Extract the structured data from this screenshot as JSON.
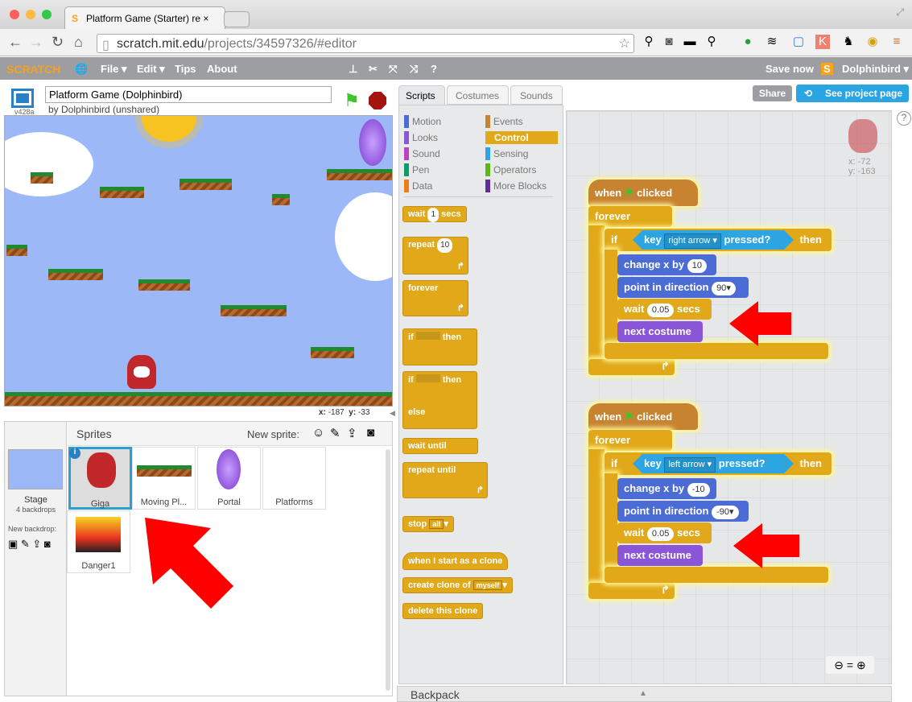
{
  "browser": {
    "tab_title": "Platform Game (Starter) re",
    "url_host": "scratch.mit.edu",
    "url_path": "/projects/34597326/#editor"
  },
  "menu": {
    "logo": "SCRATCH",
    "items": [
      "File ▾",
      "Edit ▾",
      "Tips",
      "About"
    ],
    "save_now": "Save now",
    "user": "Dolphinbird ▾"
  },
  "project": {
    "title": "Platform Game (Dolphinbird)",
    "byline": "by Dolphinbird (unshared)",
    "version": "v428a"
  },
  "stage": {
    "x_label": "x:",
    "x": "-187",
    "y_label": "y:",
    "y": "-33"
  },
  "sprites": {
    "header": "Sprites",
    "new_sprite": "New sprite:",
    "stage_label": "Stage",
    "stage_sub": "4 backdrops",
    "new_backdrop": "New backdrop:",
    "items": [
      "Giga",
      "Moving Pl...",
      "Portal",
      "Platforms",
      "Danger1"
    ]
  },
  "tabs": [
    "Scripts",
    "Costumes",
    "Sounds"
  ],
  "buttons": {
    "share": "Share",
    "see_project": "See project page"
  },
  "categories": {
    "left": [
      "Motion",
      "Looks",
      "Sound",
      "Pen",
      "Data"
    ],
    "right": [
      "Events",
      "Control",
      "Sensing",
      "Operators",
      "More Blocks"
    ],
    "selected": "Control",
    "colors": {
      "Motion": "#4a6cd4",
      "Looks": "#8a55d7",
      "Sound": "#bb42c3",
      "Pen": "#0e9a6c",
      "Data": "#ee7d16",
      "Events": "#c88330",
      "Control": "#e1a91a",
      "Sensing": "#2ca5e2",
      "Operators": "#5cb712",
      "More Blocks": "#632d99"
    }
  },
  "palette": {
    "wait": "wait",
    "wait_val": "1",
    "secs": "secs",
    "repeat": "repeat",
    "repeat_val": "10",
    "forever": "forever",
    "if": "if",
    "then": "then",
    "else": "else",
    "wait_until": "wait until",
    "repeat_until": "repeat until",
    "stop": "stop",
    "stop_val": "all",
    "clone_hat": "when I start as a clone",
    "create_clone": "create clone of",
    "create_val": "myself",
    "delete_clone": "delete this clone"
  },
  "sprite_info": {
    "x": "x: -72",
    "y": "y: -163"
  },
  "scripts": [
    {
      "when": "when",
      "clicked": "clicked",
      "forever": "forever",
      "if": "if",
      "key": "key",
      "key_val": "right arrow",
      "pressed": "pressed?",
      "then": "then",
      "change": "change x by",
      "change_val": "10",
      "point": "point in direction",
      "point_val": "90",
      "wait": "wait",
      "wait_val": "0.05",
      "secs": "secs",
      "next": "next costume"
    },
    {
      "when": "when",
      "clicked": "clicked",
      "forever": "forever",
      "if": "if",
      "key": "key",
      "key_val": "left arrow",
      "pressed": "pressed?",
      "then": "then",
      "change": "change x by",
      "change_val": "-10",
      "point": "point in direction",
      "point_val": "-90",
      "wait": "wait",
      "wait_val": "0.05",
      "secs": "secs",
      "next": "next costume"
    }
  ],
  "backpack": "Backpack",
  "annotation_color": "#ff0000"
}
